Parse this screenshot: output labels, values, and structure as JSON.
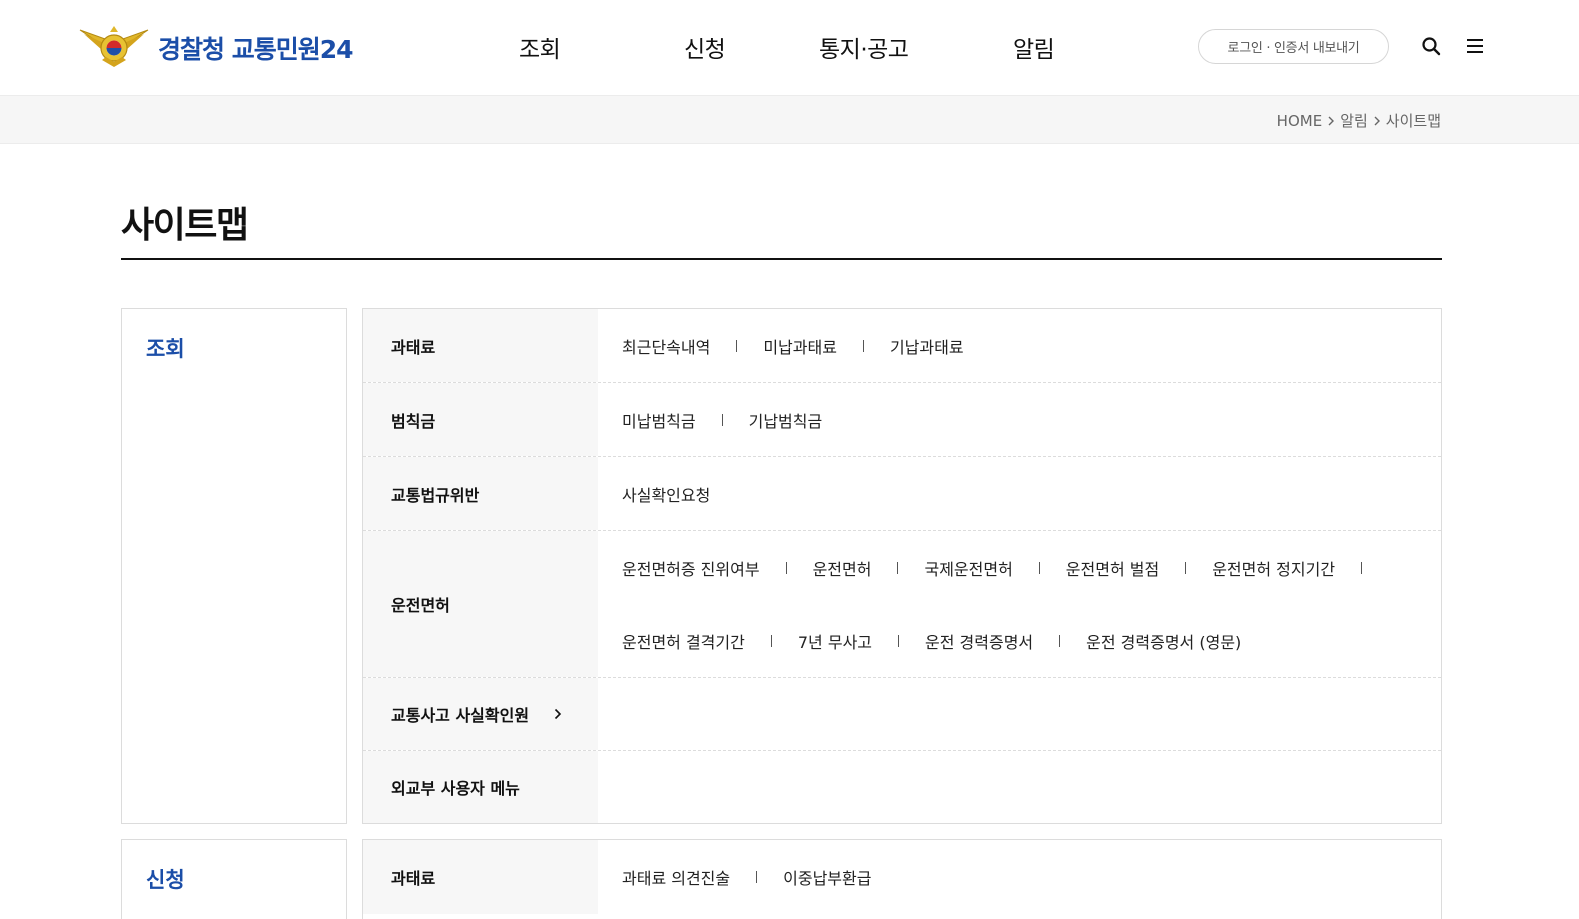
{
  "header": {
    "logo_text": "경찰청 교통민원24",
    "nav": [
      "조회",
      "신청",
      "통지·공고",
      "알림"
    ],
    "login_label": "로그인 · 인증서 내보내기"
  },
  "breadcrumb": [
    "HOME",
    "알림",
    "사이트맵"
  ],
  "page_title": "사이트맵",
  "sections": [
    {
      "name": "조회",
      "rows": [
        {
          "label": "과태료",
          "lines": [
            [
              "최근단속내역",
              "미납과태료",
              "기납과태료"
            ]
          ]
        },
        {
          "label": "범칙금",
          "lines": [
            [
              "미납범칙금",
              "기납범칙금"
            ]
          ]
        },
        {
          "label": "교통법규위반",
          "lines": [
            [
              "사실확인요청"
            ]
          ]
        },
        {
          "label": "운전면허",
          "lines": [
            [
              "운전면허증 진위여부",
              "운전면허",
              "국제운전면허",
              "운전면허 벌점",
              "운전면허 정지기간",
              ""
            ],
            [
              "운전면허 결격기간",
              "7년 무사고",
              "운전 경력증명서",
              "운전 경력증명서 (영문)"
            ]
          ]
        },
        {
          "label": "교통사고 사실확인원",
          "has_arrow": true,
          "lines": []
        },
        {
          "label": "외교부 사용자 메뉴",
          "lines": []
        }
      ]
    },
    {
      "name": "신청",
      "rows": [
        {
          "label": "과태료",
          "lines": [
            [
              "과태료 의견진술",
              "이중납부환급"
            ]
          ]
        }
      ]
    }
  ],
  "colors": {
    "brand_blue": "#1b4ea8",
    "header_gray": "#f7f7f7"
  }
}
